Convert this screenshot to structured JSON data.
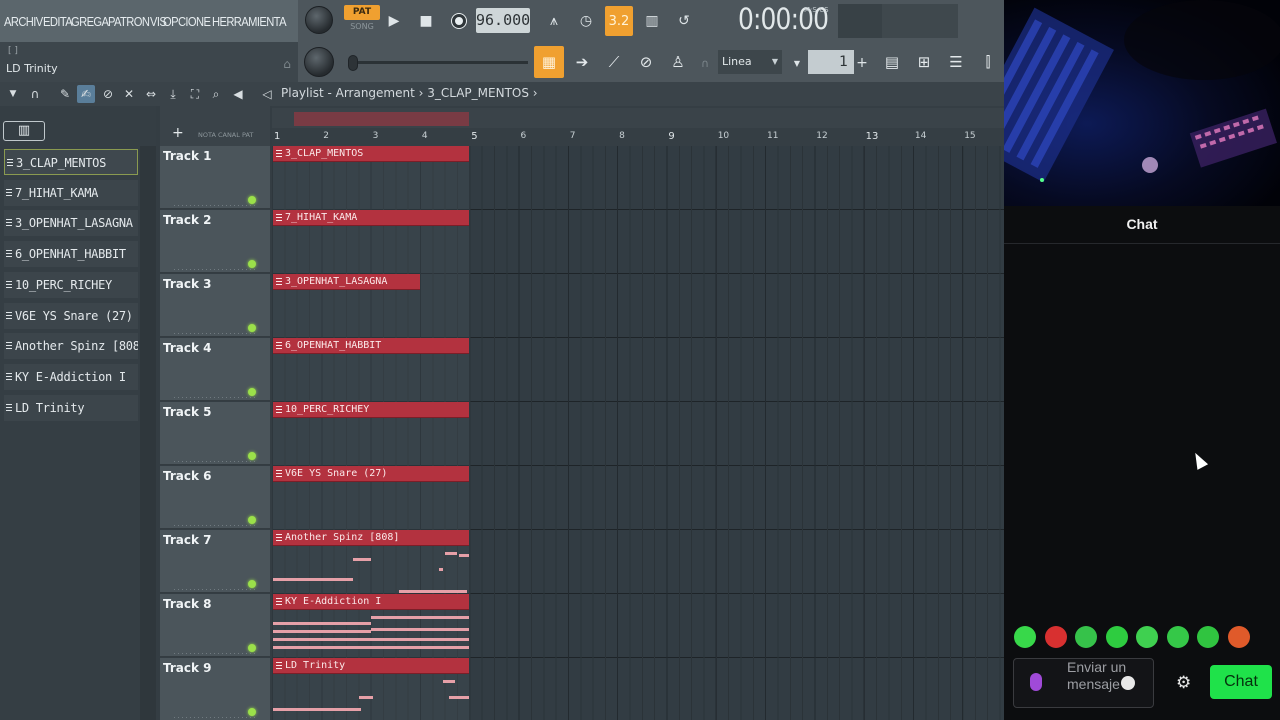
{
  "menu": [
    "ARCHIV",
    "EDITA",
    "GREGA",
    "PATRON",
    "VIS",
    "OPCIONE",
    "HERRAMIENTA"
  ],
  "transport": {
    "pat_label": "PAT",
    "song_label": "SONG",
    "tempo": "96.000",
    "pattern_display": "3.2",
    "time": "0:00:00",
    "time_unit": "M:S:CS"
  },
  "hint": {
    "bracket": "[ ]",
    "text": "LD Trinity"
  },
  "snap": {
    "value": "Linea"
  },
  "pattern_number": "1",
  "playlist": {
    "breadcrumb": "Playlist - Arrangement › 3_CLAP_MENTOS ›",
    "header_labels": "NOTA CANAL PAT"
  },
  "picker_items": [
    "3_CLAP_MENTOS",
    "7_HIHAT_KAMA",
    "3_OPENHAT_LASAGNA",
    "6_OPENHAT_HABBIT",
    "10_PERC_RICHEY",
    "V6E YS Snare (27)",
    "Another Spinz [808]",
    "KY E-Addiction I",
    "LD Trinity"
  ],
  "ruler_bars": [
    "1",
    "2",
    "3",
    "4",
    "5",
    "6",
    "7",
    "8",
    "9",
    "10",
    "11",
    "12",
    "13",
    "14",
    "15"
  ],
  "tracks": [
    {
      "name": "Track 1",
      "clip": "3_CLAP_MENTOS",
      "clip_bars": 4
    },
    {
      "name": "Track 2",
      "clip": "7_HIHAT_KAMA",
      "clip_bars": 4
    },
    {
      "name": "Track 3",
      "clip": "3_OPENHAT_LASAGNA",
      "clip_bars": 3
    },
    {
      "name": "Track 4",
      "clip": "6_OPENHAT_HABBIT",
      "clip_bars": 4
    },
    {
      "name": "Track 5",
      "clip": "10_PERC_RICHEY",
      "clip_bars": 4
    },
    {
      "name": "Track 6",
      "clip": "V6E YS Snare (27)",
      "clip_bars": 4
    },
    {
      "name": "Track 7",
      "clip": "Another Spinz [808]",
      "clip_bars": 4
    },
    {
      "name": "Track 8",
      "clip": "KY E-Addiction I",
      "clip_bars": 4
    },
    {
      "name": "Track 9",
      "clip": "LD Trinity",
      "clip_bars": 4
    }
  ],
  "chat": {
    "title": "Chat",
    "placeholder": "Enviar un mensaje",
    "send_label": "Chat"
  },
  "colors": {
    "clip": "#b3323f",
    "accent": "#f0a030",
    "chat_button": "#1fe24a",
    "led": "#9be04a"
  }
}
